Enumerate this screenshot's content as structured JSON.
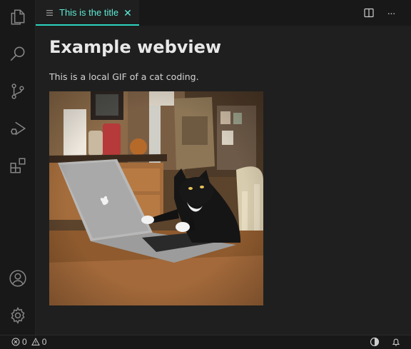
{
  "editor": {
    "tab": {
      "title": "This is the title",
      "close_glyph": "✕",
      "icon": "preview-icon"
    },
    "actions": {
      "split_icon": "split-editor-icon",
      "more_glyph": "···"
    }
  },
  "activity_bar": {
    "items": [
      {
        "name": "explorer-icon"
      },
      {
        "name": "search-icon"
      },
      {
        "name": "source-control-icon"
      },
      {
        "name": "run-debug-icon"
      },
      {
        "name": "extensions-icon"
      }
    ],
    "bottom": [
      {
        "name": "account-icon"
      },
      {
        "name": "settings-gear-icon"
      }
    ]
  },
  "webview": {
    "heading": "Example webview",
    "description": "This is a local GIF of a cat coding.",
    "image_alt": "cat coding gif"
  },
  "status_bar": {
    "errors": "0",
    "warnings": "0",
    "right_icons": [
      "theme-icon",
      "bell-icon"
    ]
  },
  "colors": {
    "accent": "#2dd4bf",
    "background": "#1f1f1f",
    "sidebar": "#181818"
  }
}
